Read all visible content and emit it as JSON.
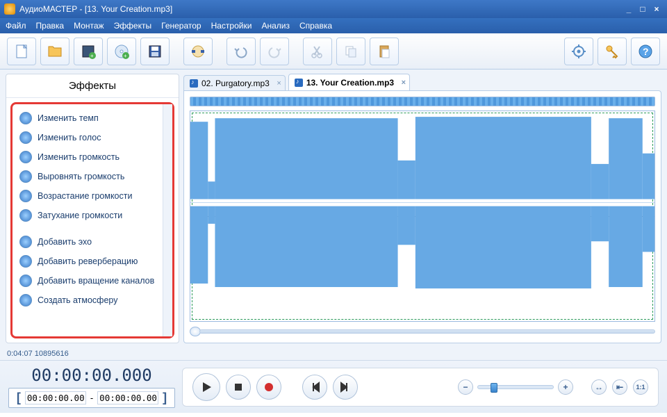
{
  "window": {
    "title": "АудиоМАСТЕР - [13. Your Creation.mp3]"
  },
  "menu": [
    "Файл",
    "Правка",
    "Монтаж",
    "Эффекты",
    "Генератор",
    "Настройки",
    "Анализ",
    "Справка"
  ],
  "sidebar": {
    "title": "Эффекты",
    "items": [
      "Изменить темп",
      "Изменить голос",
      "Изменить громкость",
      "Выровнять громкость",
      "Возрастание громкости",
      "Затухание громкости"
    ],
    "items2": [
      "Добавить эхо",
      "Добавить реверберацию",
      "Добавить вращение каналов",
      "Создать атмосферу"
    ]
  },
  "tabs": [
    {
      "label": "02. Purgatory.mp3",
      "active": false
    },
    {
      "label": "13. Your Creation.mp3",
      "active": true
    }
  ],
  "status": "0:04:07 10895616",
  "transport": {
    "current": "00:00:00.000",
    "sel_start": "00:00:00.000",
    "sel_end": "00:00:00.000",
    "dash": "-"
  }
}
